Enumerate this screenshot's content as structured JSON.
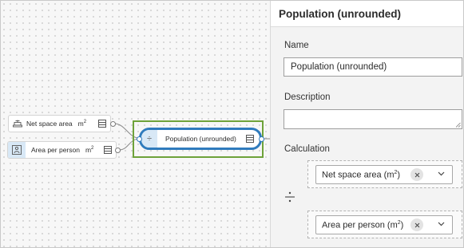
{
  "canvas": {
    "nodes": [
      {
        "label": "Net space area",
        "unit": "m",
        "unit_sup": "2",
        "icon": "building-floors-icon"
      },
      {
        "label": "Area per person",
        "unit": "m",
        "unit_sup": "2",
        "icon": "person-area-icon"
      }
    ],
    "selected_node": {
      "label": "Population (unrounded)",
      "icon": "divide-icon",
      "symbol": "÷"
    }
  },
  "panel": {
    "title": "Population (unrounded)",
    "name_label": "Name",
    "name_value": "Population (unrounded)",
    "description_label": "Description",
    "description_value": "",
    "calculation_label": "Calculation",
    "operator_symbol": "÷",
    "operands": [
      {
        "label": "Net space area (m",
        "sup": "2",
        "suffix": ")"
      },
      {
        "label": "Area per person (m",
        "sup": "2",
        "suffix": ")"
      }
    ]
  },
  "colors": {
    "selection_outline": "#6ea23a",
    "node_border_selected": "#2f7bbd",
    "icon_tint": "#d8e8f6"
  }
}
